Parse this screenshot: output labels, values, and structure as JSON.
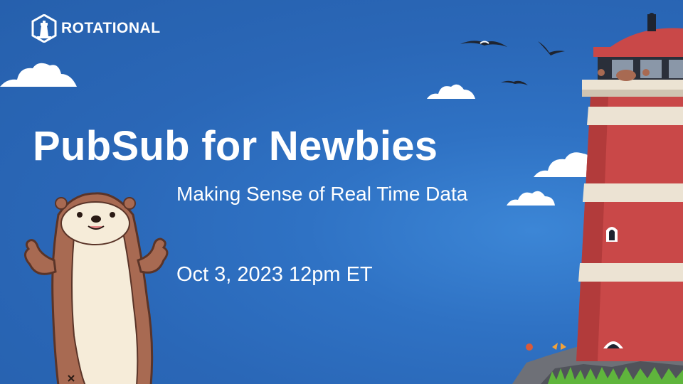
{
  "brand": {
    "name": "ROTATIONAL",
    "logo_icon": "lighthouse-hexagon-icon"
  },
  "slide": {
    "title": "PubSub for Newbies",
    "subtitle": "Making Sense of Real Time Data",
    "event_date": "Oct 3, 2023 12pm ET"
  },
  "illustrations": [
    "otter-mascot",
    "lighthouse",
    "seagulls",
    "clouds",
    "butterfly"
  ],
  "colors": {
    "background": "#2a67b7",
    "lighthouse_red": "#c94848",
    "lighthouse_stripe": "#ece3d3",
    "otter_brown": "#a86a52",
    "otter_belly": "#f6ecd9",
    "grass": "#5fb53c"
  }
}
